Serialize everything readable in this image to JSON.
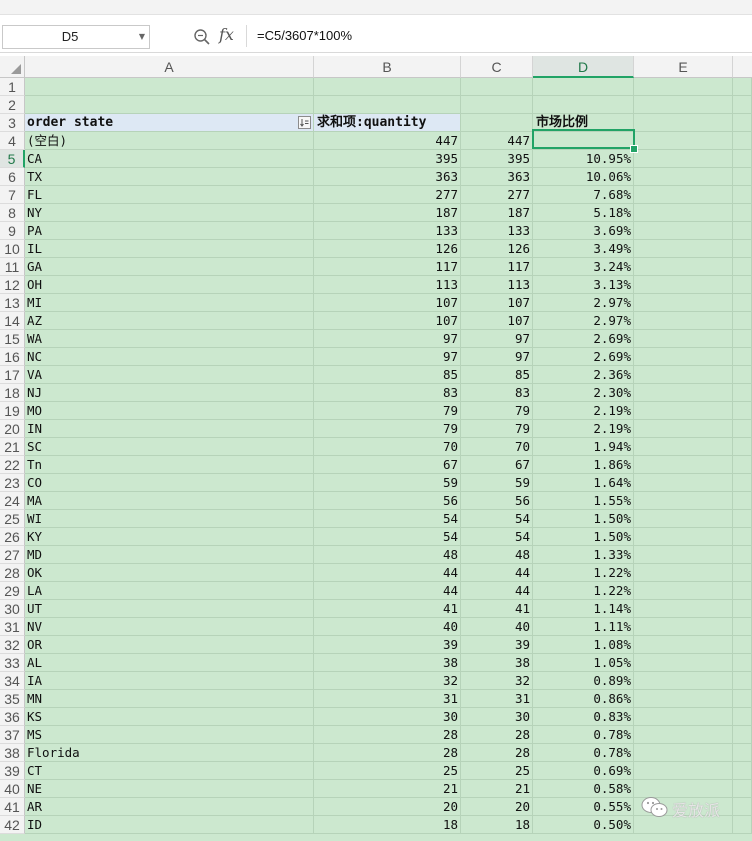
{
  "name_box": "D5",
  "formula_bar": {
    "fx_label": "fx",
    "formula": "=C5/3607*100%"
  },
  "columns": [
    "A",
    "B",
    "C",
    "D",
    "E"
  ],
  "selected_cell": {
    "column": "D",
    "row": "5"
  },
  "pivot_header": {
    "A": "order state",
    "B": "求和项:quantity",
    "D": "市场比例"
  },
  "rows": [
    {
      "n": "1",
      "A": "",
      "B": "",
      "C": "",
      "D": ""
    },
    {
      "n": "2",
      "A": "",
      "B": "",
      "C": "",
      "D": ""
    },
    {
      "n": "3",
      "header": true
    },
    {
      "n": "4",
      "A": "(空白)",
      "B": "447",
      "C": "447",
      "D": ""
    },
    {
      "n": "5",
      "A": "CA",
      "B": "395",
      "C": "395",
      "D": "10.95%"
    },
    {
      "n": "6",
      "A": "TX",
      "B": "363",
      "C": "363",
      "D": "10.06%"
    },
    {
      "n": "7",
      "A": "FL",
      "B": "277",
      "C": "277",
      "D": "7.68%"
    },
    {
      "n": "8",
      "A": "NY",
      "B": "187",
      "C": "187",
      "D": "5.18%"
    },
    {
      "n": "9",
      "A": "PA",
      "B": "133",
      "C": "133",
      "D": "3.69%"
    },
    {
      "n": "10",
      "A": "IL",
      "B": "126",
      "C": "126",
      "D": "3.49%"
    },
    {
      "n": "11",
      "A": "GA",
      "B": "117",
      "C": "117",
      "D": "3.24%"
    },
    {
      "n": "12",
      "A": "OH",
      "B": "113",
      "C": "113",
      "D": "3.13%"
    },
    {
      "n": "13",
      "A": "MI",
      "B": "107",
      "C": "107",
      "D": "2.97%"
    },
    {
      "n": "14",
      "A": "AZ",
      "B": "107",
      "C": "107",
      "D": "2.97%"
    },
    {
      "n": "15",
      "A": "WA",
      "B": "97",
      "C": "97",
      "D": "2.69%"
    },
    {
      "n": "16",
      "A": "NC",
      "B": "97",
      "C": "97",
      "D": "2.69%"
    },
    {
      "n": "17",
      "A": "VA",
      "B": "85",
      "C": "85",
      "D": "2.36%"
    },
    {
      "n": "18",
      "A": "NJ",
      "B": "83",
      "C": "83",
      "D": "2.30%"
    },
    {
      "n": "19",
      "A": "MO",
      "B": "79",
      "C": "79",
      "D": "2.19%"
    },
    {
      "n": "20",
      "A": "IN",
      "B": "79",
      "C": "79",
      "D": "2.19%"
    },
    {
      "n": "21",
      "A": "SC",
      "B": "70",
      "C": "70",
      "D": "1.94%"
    },
    {
      "n": "22",
      "A": "Tn",
      "B": "67",
      "C": "67",
      "D": "1.86%"
    },
    {
      "n": "23",
      "A": "CO",
      "B": "59",
      "C": "59",
      "D": "1.64%"
    },
    {
      "n": "24",
      "A": "MA",
      "B": "56",
      "C": "56",
      "D": "1.55%"
    },
    {
      "n": "25",
      "A": "WI",
      "B": "54",
      "C": "54",
      "D": "1.50%"
    },
    {
      "n": "26",
      "A": "KY",
      "B": "54",
      "C": "54",
      "D": "1.50%"
    },
    {
      "n": "27",
      "A": "MD",
      "B": "48",
      "C": "48",
      "D": "1.33%"
    },
    {
      "n": "28",
      "A": "OK",
      "B": "44",
      "C": "44",
      "D": "1.22%"
    },
    {
      "n": "29",
      "A": "LA",
      "B": "44",
      "C": "44",
      "D": "1.22%"
    },
    {
      "n": "30",
      "A": "UT",
      "B": "41",
      "C": "41",
      "D": "1.14%"
    },
    {
      "n": "31",
      "A": "NV",
      "B": "40",
      "C": "40",
      "D": "1.11%"
    },
    {
      "n": "32",
      "A": "OR",
      "B": "39",
      "C": "39",
      "D": "1.08%"
    },
    {
      "n": "33",
      "A": "AL",
      "B": "38",
      "C": "38",
      "D": "1.05%"
    },
    {
      "n": "34",
      "A": "IA",
      "B": "32",
      "C": "32",
      "D": "0.89%"
    },
    {
      "n": "35",
      "A": "MN",
      "B": "31",
      "C": "31",
      "D": "0.86%"
    },
    {
      "n": "36",
      "A": "KS",
      "B": "30",
      "C": "30",
      "D": "0.83%"
    },
    {
      "n": "37",
      "A": "MS",
      "B": "28",
      "C": "28",
      "D": "0.78%"
    },
    {
      "n": "38",
      "A": "Florida",
      "B": "28",
      "C": "28",
      "D": "0.78%"
    },
    {
      "n": "39",
      "A": "CT",
      "B": "25",
      "C": "25",
      "D": "0.69%"
    },
    {
      "n": "40",
      "A": "NE",
      "B": "21",
      "C": "21",
      "D": "0.58%"
    },
    {
      "n": "41",
      "A": "AR",
      "B": "20",
      "C": "20",
      "D": "0.55%"
    },
    {
      "n": "42",
      "A": "ID",
      "B": "18",
      "C": "18",
      "D": "0.50%"
    }
  ],
  "watermark": "爱放派",
  "colors": {
    "cell_fill": "#cce8cf",
    "pivot_header_fill": "#dde8f4",
    "selection": "#21a366"
  }
}
